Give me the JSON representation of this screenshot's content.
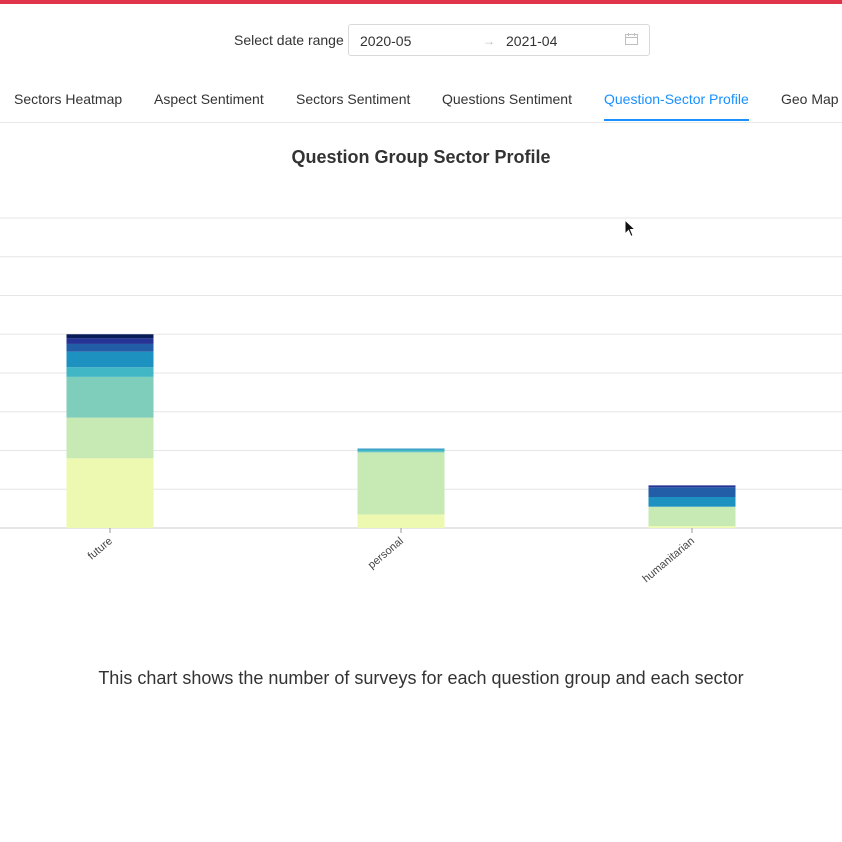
{
  "date_range": {
    "label": "Select date range",
    "start": "2020-05",
    "end": "2021-04",
    "separator": "→"
  },
  "tabs": [
    {
      "label": "Sectors Heatmap",
      "active": false
    },
    {
      "label": "Aspect Sentiment",
      "active": false
    },
    {
      "label": "Sectors Sentiment",
      "active": false
    },
    {
      "label": "Questions Sentiment",
      "active": false
    },
    {
      "label": "Question-Sector Profile",
      "active": true
    },
    {
      "label": "Geo Map",
      "active": false
    }
  ],
  "accent_color": "#1890ff",
  "topbar_color": "#e0344a",
  "chart_data": {
    "type": "bar",
    "stacked": true,
    "title": "Question Group Sector Profile",
    "categories": [
      "future",
      "personal",
      "humanitarian"
    ],
    "ylim": [
      0,
      8
    ],
    "grid": true,
    "series": [
      {
        "color": "#edf8b1",
        "values": [
          1.8,
          0.35,
          0.05
        ]
      },
      {
        "color": "#c7e9b4",
        "values": [
          1.05,
          1.6,
          0.5
        ]
      },
      {
        "color": "#7fcdbb",
        "values": [
          1.05,
          0.02,
          0.0
        ]
      },
      {
        "color": "#41b6c4",
        "values": [
          0.25,
          0.05,
          0.0
        ]
      },
      {
        "color": "#1d91c0",
        "values": [
          0.4,
          0.03,
          0.25
        ]
      },
      {
        "color": "#225ea8",
        "values": [
          0.2,
          0.0,
          0.25
        ]
      },
      {
        "color": "#253494",
        "values": [
          0.15,
          0.0,
          0.05
        ]
      },
      {
        "color": "#081d58",
        "values": [
          0.1,
          0.0,
          0.0
        ]
      }
    ]
  },
  "caption": "This chart shows the number of surveys for each question group and each sector"
}
